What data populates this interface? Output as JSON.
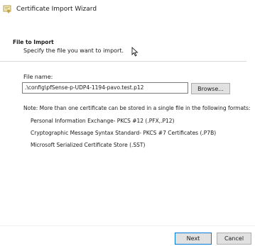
{
  "window": {
    "title": "Certificate Import Wizard",
    "icon": "certificate-icon"
  },
  "header": {
    "title": "File to Import",
    "subtitle": "Specify the file you want to import."
  },
  "file": {
    "label": "File name:",
    "value": ".\\config\\pfSense-p-UDP4-1194-pavo.test.p12",
    "browse_label": "Browse..."
  },
  "note": {
    "text": "Note:  More than one certificate can be stored in a single file in the following formats:",
    "formats": [
      "Personal Information Exchange- PKCS #12 (.PFX,.P12)",
      "Cryptographic Message Syntax Standard- PKCS #7 Certificates (.P7B)",
      "Microsoft Serialized Certificate Store (.SST)"
    ]
  },
  "footer": {
    "next_label": "Next",
    "cancel_label": "Cancel"
  },
  "colors": {
    "accent": "#0078d7",
    "button_bg": "#e1e1e1"
  }
}
